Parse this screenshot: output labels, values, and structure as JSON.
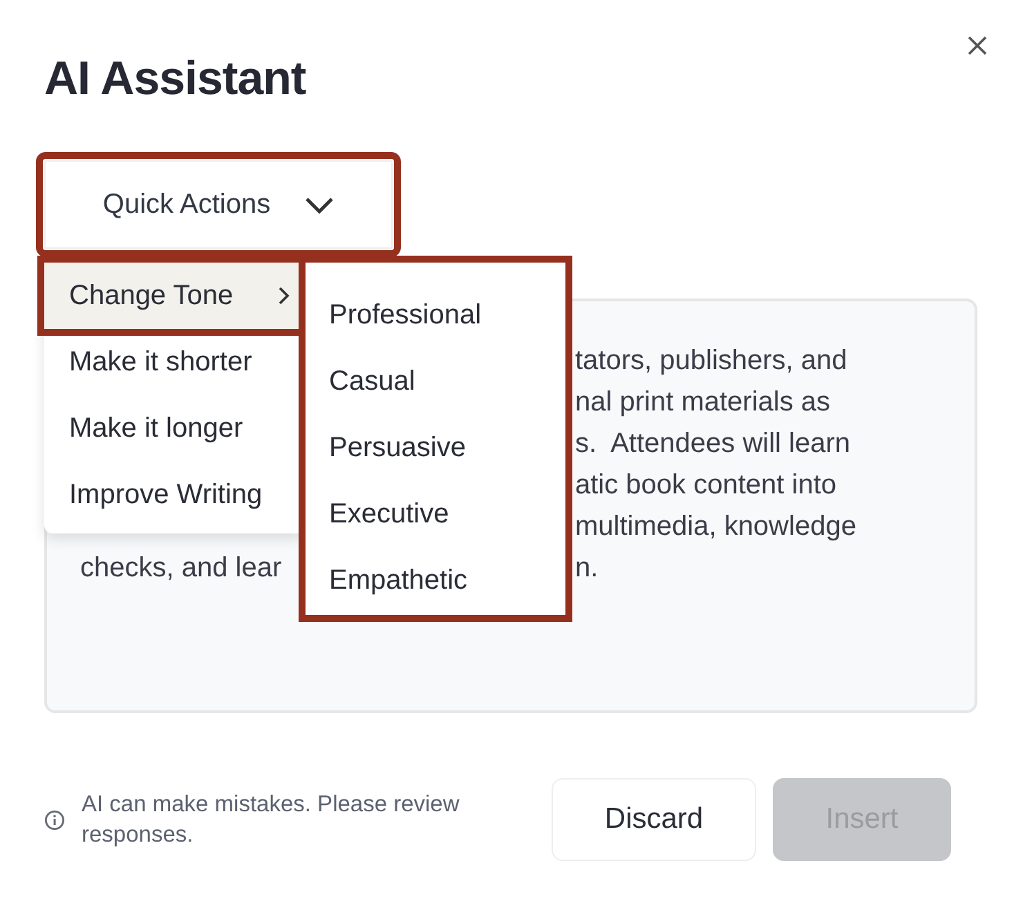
{
  "title": "AI Assistant",
  "quick_actions": {
    "label": "Quick Actions",
    "annotated": true
  },
  "menu": [
    {
      "label": "Change Tone",
      "selected": true,
      "annotated": true,
      "kind": "submenu"
    },
    {
      "label": "Make it shorter",
      "selected": false,
      "annotated": false,
      "kind": "action"
    },
    {
      "label": "Make it longer",
      "selected": false,
      "annotated": false,
      "kind": "action"
    },
    {
      "label": "Improve Writing",
      "selected": false,
      "annotated": false,
      "kind": "action"
    }
  ],
  "submenu": {
    "annotated": true,
    "items": [
      "Professional",
      "Casual",
      "Persuasive",
      "Executive",
      "Empathetic"
    ]
  },
  "text_lines": [
    {
      "right": "tators, publishers, and"
    },
    {
      "right": "nal print materials as"
    },
    {
      "right": "s.  Attendees will learn"
    },
    {
      "right": "atic book content into"
    },
    {
      "right": "multimedia, knowledge"
    },
    {
      "left": "checks, and lear",
      "right": "n."
    }
  ],
  "notice": "AI can make mistakes. Please review responses.",
  "buttons": [
    {
      "label": "Discard",
      "disabled": false
    },
    {
      "label": "Insert",
      "disabled": true
    }
  ]
}
